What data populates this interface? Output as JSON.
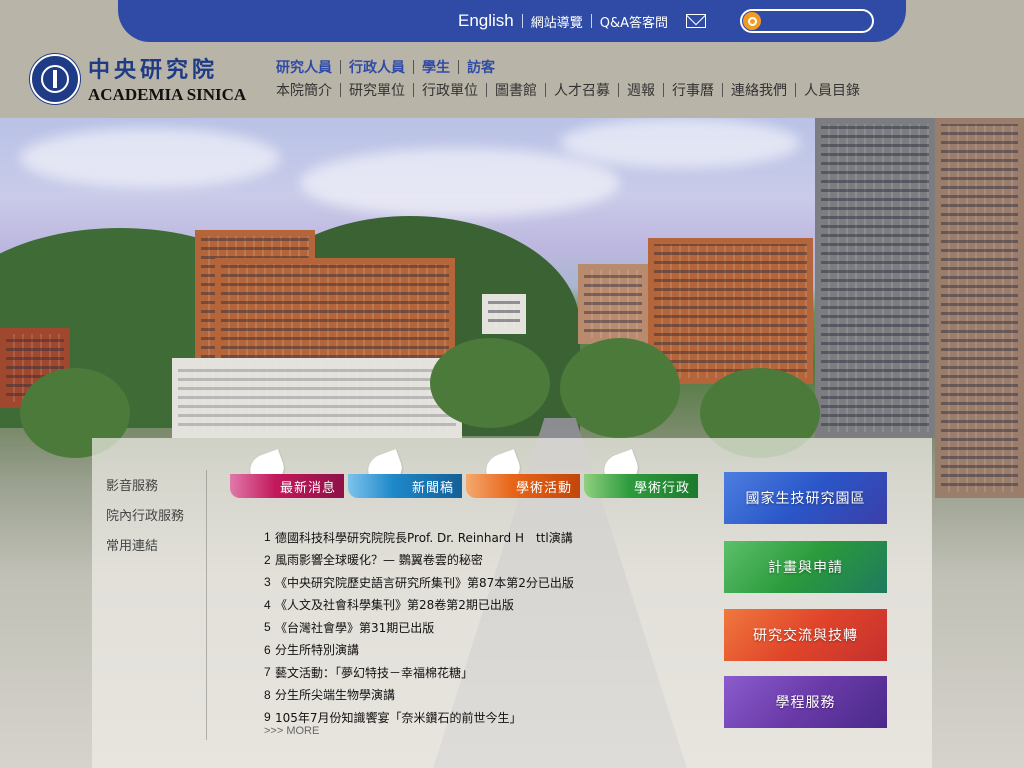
{
  "colors": {
    "brand_blue": "#2f4ba5",
    "search_orange": "#f29b22",
    "header_bg": "#b9b4a8",
    "tab_news": "#c2185b",
    "tab_press": "#1e88c8",
    "tab_events": "#e8651a",
    "tab_admin": "#2e9b3e",
    "btn_biotech": "#2a56c8",
    "btn_plans": "#2a9a3c",
    "btn_exchange": "#e0452a",
    "btn_courses": "#6a3aa8"
  },
  "top_bar": {
    "english": "English",
    "sitemap": "網站導覽",
    "qa": "Q&A答客問",
    "mail_icon": "mail-icon",
    "search_icon": "search-icon",
    "search_value": ""
  },
  "logo": {
    "name_cn": "中央研究院",
    "name_en": "ACADEMIA SINICA"
  },
  "nav_primary": [
    "研究人員",
    "行政人員",
    "學生",
    "訪客"
  ],
  "nav_secondary": [
    "本院簡介",
    "研究單位",
    "行政單位",
    "圖書館",
    "人才召募",
    "週報",
    "行事曆",
    "連絡我們",
    "人員目錄"
  ],
  "side_menu": [
    "影音服務",
    "院內行政服務",
    "常用連結"
  ],
  "tabs": [
    "最新消息",
    "新聞稿",
    "學術活動",
    "學術行政"
  ],
  "news": [
    {
      "num": "1",
      "text": "德國科技科學研究院院長Prof. Dr. Reinhard H　ttl演講"
    },
    {
      "num": "2",
      "text": "風雨影響全球暖化？— 鸚翼卷雲的秘密"
    },
    {
      "num": "3",
      "text": "《中央研究院歷史語言研究所集刊》第87本第2分已出版"
    },
    {
      "num": "4",
      "text": "《人文及社會科學集刊》第28卷第2期已出版"
    },
    {
      "num": "5",
      "text": "《台灣社會學》第31期已出版"
    },
    {
      "num": "6",
      "text": "分生所特別演講"
    },
    {
      "num": "7",
      "text": "藝文活動：「夢幻特技－幸福棉花糖」"
    },
    {
      "num": "8",
      "text": "分生所尖端生物學演講"
    },
    {
      "num": "9",
      "text": "105年7月份知識饗宴「奈米鑽石的前世今生」"
    }
  ],
  "more": ">>> MORE",
  "right_buttons": [
    "國家生技研究園區",
    "計畫與申請",
    "研究交流與技轉",
    "學程服務"
  ]
}
